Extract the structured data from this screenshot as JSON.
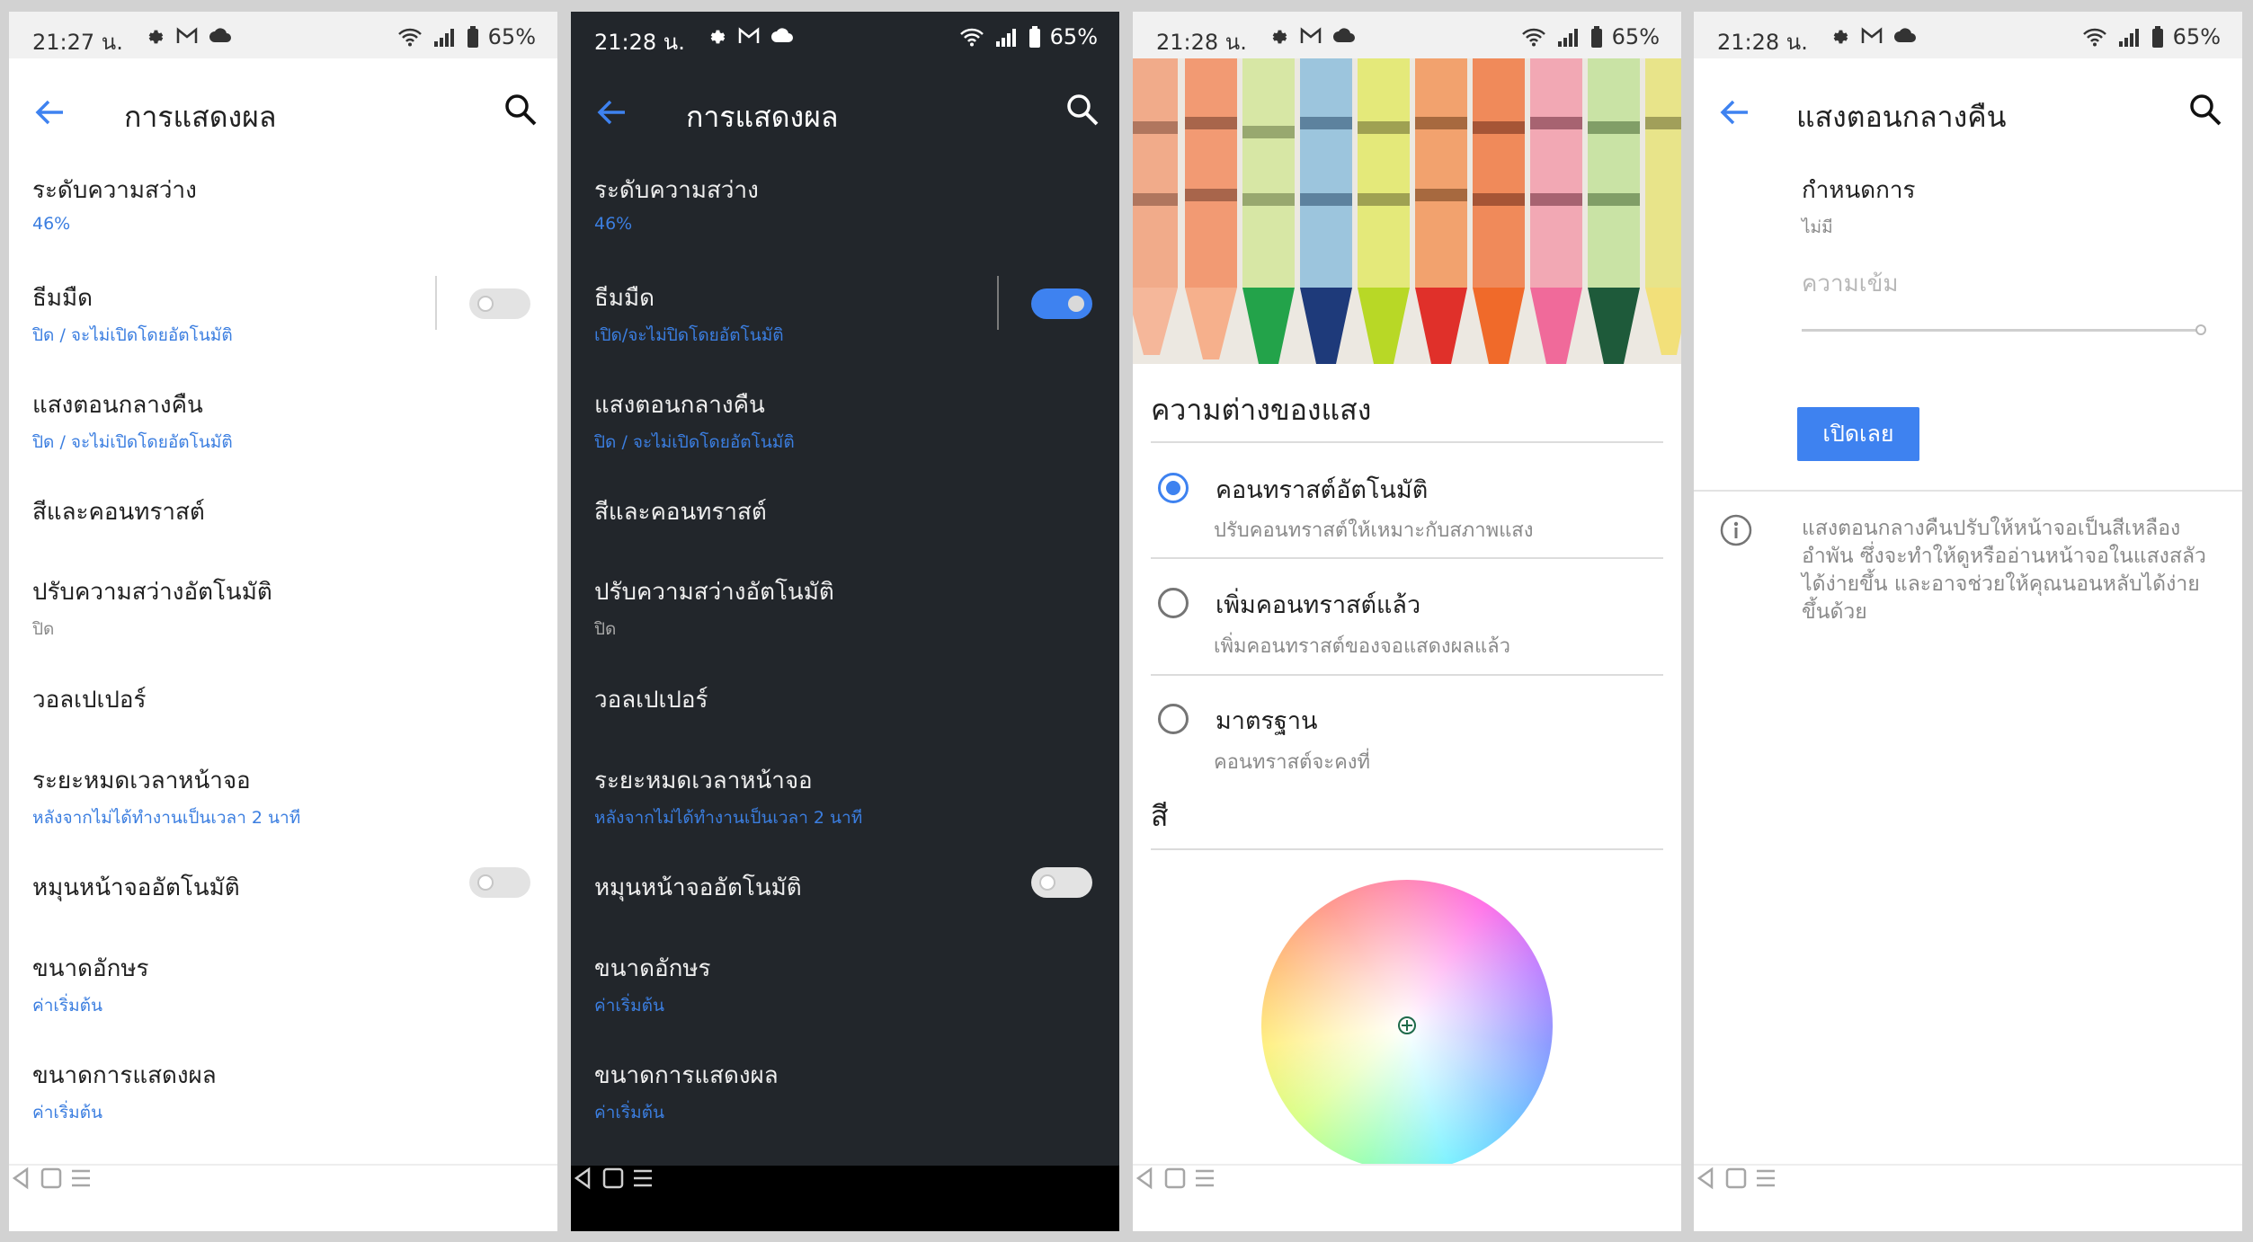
{
  "colors": {
    "accent": "#3e82f0",
    "dark_bg": "#22262b",
    "light_bg": "#ffffff",
    "frame": "#d2d2d2"
  },
  "status_bars": [
    {
      "time": "21:27 น.",
      "battery": "65%"
    },
    {
      "time": "21:28 น.",
      "battery": "65%"
    },
    {
      "time": "21:28 น.",
      "battery": "65%"
    },
    {
      "time": "21:28 น.",
      "battery": "65%"
    }
  ],
  "display_settings": {
    "title": "การแสดงผล",
    "items": [
      {
        "title": "ระดับความสว่าง",
        "subtitle": "46%"
      },
      {
        "title": "ธีมมืด",
        "subtitle": "ปิด / จะไม่เปิดโดยอัตโนมัติ"
      },
      {
        "title": "แสงตอนกลางคืน",
        "subtitle": "ปิด / จะไม่เปิดโดยอัตโนมัติ"
      },
      {
        "title": "สีและคอนทราสต์",
        "subtitle": ""
      },
      {
        "title": "ปรับความสว่างอัตโนมัติ",
        "subtitle": "ปิด"
      },
      {
        "title": "วอลเปเปอร์",
        "subtitle": ""
      },
      {
        "title": "ระยะหมดเวลาหน้าจอ",
        "subtitle": "หลังจากไม่ได้ทำงานเป็นเวลา 2 นาที"
      },
      {
        "title": "หมุนหน้าจออัตโนมัติ",
        "subtitle": ""
      },
      {
        "title": "ขนาดอักษร",
        "subtitle": "ค่าเริ่มต้น"
      },
      {
        "title": "ขนาดการแสดงผล",
        "subtitle": "ค่าเริ่มต้น"
      }
    ],
    "dark_theme_subtitle_on": "เปิด/จะไม่ปิดโดยอัตโนมัติ",
    "dark_theme_on": [
      false,
      true
    ],
    "auto_rotate_on": [
      false,
      false
    ]
  },
  "color_contrast": {
    "section_title": "ความต่างของแสง",
    "options": [
      {
        "title": "คอนทราสต์อัตโนมัติ",
        "subtitle": "ปรับคอนทราสต์ให้เหมาะกับสภาพแสง",
        "selected": true
      },
      {
        "title": "เพิ่มคอนทราสต์แล้ว",
        "subtitle": "เพิ่มคอนทราสต์ของจอแสดงผลแล้ว",
        "selected": false
      },
      {
        "title": "มาตรฐาน",
        "subtitle": "คอนทราสต์จะคงที่",
        "selected": false
      }
    ],
    "color_title": "สี"
  },
  "night_light": {
    "title": "แสงตอนกลางคืน",
    "schedule_label": "กำหนดการ",
    "schedule_value": "ไม่มี",
    "intensity_label": "ความเข้ม",
    "turn_on_button": "เปิดเลย",
    "info": "แสงตอนกลางคืนปรับให้หน้าจอเป็นสีเหลืองอำพัน ซึ่งจะทำให้ดูหรืออ่านหน้าจอในแสงสลัวได้ง่ายขึ้น และอาจช่วยให้คุณนอนหลับได้ง่ายขึ้นด้วย"
  },
  "icons": [
    "settings-icon",
    "gmail-icon",
    "cloud-icon",
    "wifi-icon",
    "signal-icon",
    "battery-icon",
    "back-arrow-icon",
    "search-icon",
    "info-icon",
    "nav-back-icon",
    "nav-home-icon",
    "nav-recents-icon"
  ]
}
